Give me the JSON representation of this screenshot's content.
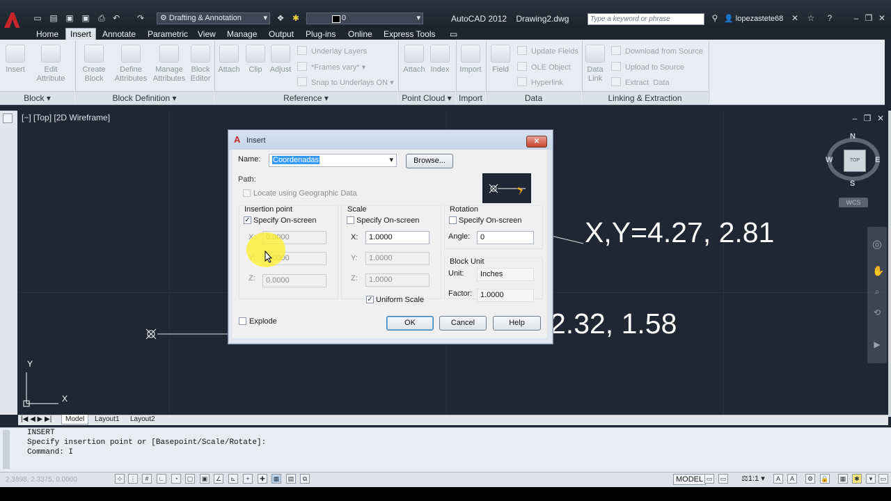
{
  "titlebar": {
    "workspace": "Drafting & Annotation",
    "layer_value": "0",
    "app_title": "AutoCAD 2012    Drawing2.dwg",
    "search_placeholder": "Type a keyword or phrase",
    "username": "lopezastete68"
  },
  "ribbon_tabs": [
    "Home",
    "Insert",
    "Annotate",
    "Parametric",
    "View",
    "Manage",
    "Output",
    "Plug-ins",
    "Online",
    "Express Tools"
  ],
  "ribbon": {
    "insert": "Insert",
    "edit_attribute": "Edit\nAttribute",
    "create_block": "Create\nBlock",
    "define_attributes": "Define\nAttributes",
    "manage_attributes": "Manage\nAttributes",
    "block_editor": "Block\nEditor",
    "attach": "Attach",
    "clip": "Clip",
    "adjust": "Adjust",
    "underlay_layers": "Underlay Layers",
    "frames_vary": "*Frames vary*",
    "snap_underlays": "Snap to Underlays ON",
    "pc_attach": "Attach",
    "pc_index": "Index",
    "import": "Import",
    "field": "Field",
    "update_fields": "Update Fields",
    "ole_object": "OLE Object",
    "hyperlink": "Hyperlink",
    "data_link": "Data\nLink",
    "download_source": "Download from Source",
    "upload_source": "Upload to Source",
    "extract_data": "Extract  Data"
  },
  "panels": {
    "block": "Block",
    "block_definition": "Block Definition",
    "reference": "Reference",
    "point_cloud": "Point Cloud",
    "import": "Import",
    "data": "Data",
    "linking": "Linking & Extraction"
  },
  "viewport": {
    "label": "[−] [Top] [2D Wireframe]",
    "compass": {
      "n": "N",
      "s": "S",
      "e": "E",
      "w": "W",
      "top": "TOP"
    },
    "wcs": "WCS",
    "coord1": "X,Y=4.27, 2.81",
    "coord2": "2.32, 1.58",
    "ucs_y": "Y",
    "ucs_x": "X"
  },
  "dialog": {
    "title": "Insert",
    "name_label": "Name:",
    "name_value": "Coordenadas",
    "browse": "Browse...",
    "path_label": "Path:",
    "geo_label": "Locate using Geographic Data",
    "insertion": {
      "title": "Insertion point",
      "specify": "Specify On-screen",
      "x_label": "X:",
      "x": "0.0000",
      "y_label": "Y:",
      "y": "0.0000",
      "z_label": "Z:",
      "z": "0.0000"
    },
    "scale": {
      "title": "Scale",
      "specify": "Specify On-screen",
      "x_label": "X:",
      "x": "1.0000",
      "y_label": "Y:",
      "y": "1.0000",
      "z_label": "Z:",
      "z": "1.0000",
      "uniform": "Uniform Scale"
    },
    "rotation": {
      "title": "Rotation",
      "specify": "Specify On-screen",
      "angle_label": "Angle:",
      "angle": "0"
    },
    "block_unit": {
      "title": "Block Unit",
      "unit_label": "Unit:",
      "unit": "Inches",
      "factor_label": "Factor:",
      "factor": "1.0000"
    },
    "explode": "Explode",
    "ok": "OK",
    "cancel": "Cancel",
    "help": "Help"
  },
  "layout_tabs": [
    "Model",
    "Layout1",
    "Layout2"
  ],
  "command_lines": [
    "INSERT",
    "Specify insertion point or [Basepoint/Scale/Rotate]:",
    "Command: I"
  ],
  "status": {
    "coords": "2.3898, 2.3375, 0.0000",
    "model": "MODEL",
    "annotation_scale": "1:1"
  }
}
